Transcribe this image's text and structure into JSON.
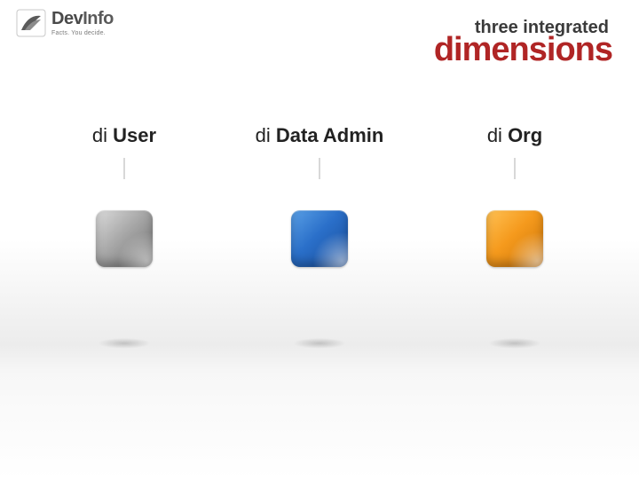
{
  "brand": {
    "name_part1": "Dev",
    "name_part2": "Info",
    "tagline": "Facts. You decide."
  },
  "title": {
    "line1": "three integrated",
    "line2": "dimensions"
  },
  "columns": [
    {
      "prefix": "di ",
      "label": "User",
      "tile_color": "#8a8a8a"
    },
    {
      "prefix": "di ",
      "label": "Data Admin",
      "tile_color": "#2a6fc9"
    },
    {
      "prefix": "di ",
      "label": "Org",
      "tile_color": "#f59a1d"
    }
  ]
}
